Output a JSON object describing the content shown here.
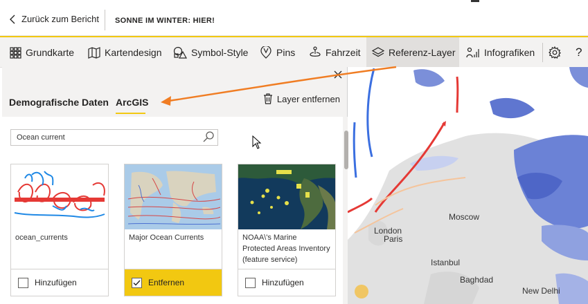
{
  "topbar": {
    "back_label": "Zurück zum Bericht",
    "report_title": "SONNE IM WINTER: HIER!"
  },
  "ribbon": {
    "items": [
      {
        "label": "Grundkarte",
        "icon": "grid-icon"
      },
      {
        "label": "Kartendesign",
        "icon": "map-icon"
      },
      {
        "label": "Symbol-Style",
        "icon": "shapes-icon"
      },
      {
        "label": "Pins",
        "icon": "pin-icon"
      },
      {
        "label": "Fahrzeit",
        "icon": "drive-time-icon"
      },
      {
        "label": "Referenz-Layer",
        "icon": "layers-icon",
        "active": true
      },
      {
        "label": "Infografiken",
        "icon": "infographics-icon"
      }
    ],
    "settings_icon": "gear-icon",
    "help_label": "?"
  },
  "panel": {
    "tabs": [
      "Demografische Daten",
      "ArcGIS"
    ],
    "active_tab": "ArcGIS",
    "remove_layer_label": "Layer entfernen",
    "search_value": "Ocean current",
    "cards": [
      {
        "title": "ocean_currents",
        "action": "Hinzufügen",
        "checked": false
      },
      {
        "title": "Major Ocean Currents",
        "action": "Entfernen",
        "checked": true
      },
      {
        "title": "NOAA\\'s Marine Protected Areas Inventory (feature service)",
        "action": "Hinzufügen",
        "checked": false
      }
    ]
  },
  "map": {
    "labels": [
      "London",
      "Paris",
      "Moscow",
      "Istanbul",
      "Baghdad",
      "New Delhi"
    ]
  },
  "colors": {
    "accent_yellow": "#f2c811",
    "annotation_arrow": "#f07d23"
  }
}
